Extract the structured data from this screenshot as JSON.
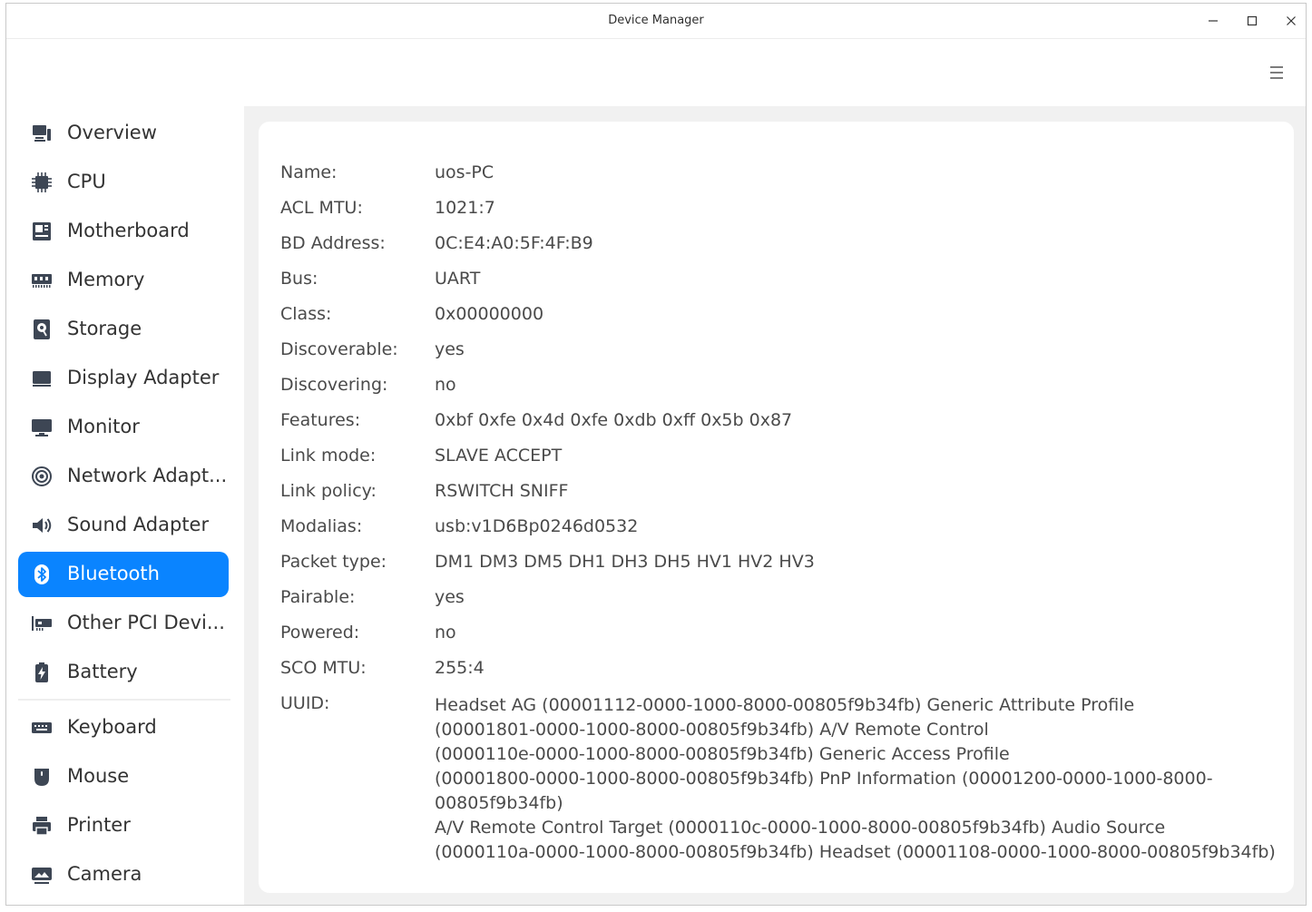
{
  "window": {
    "title": "Device Manager",
    "controls": {
      "minimize": "minimize",
      "maximize": "maximize",
      "close": "close"
    }
  },
  "sidebar": {
    "items": [
      {
        "label": "Overview",
        "icon": "overview-icon"
      },
      {
        "label": "CPU",
        "icon": "cpu-icon"
      },
      {
        "label": "Motherboard",
        "icon": "motherboard-icon"
      },
      {
        "label": "Memory",
        "icon": "memory-icon"
      },
      {
        "label": "Storage",
        "icon": "storage-icon"
      },
      {
        "label": "Display Adapter",
        "icon": "display-adapter-icon"
      },
      {
        "label": "Monitor",
        "icon": "monitor-icon"
      },
      {
        "label": "Network Adapt...",
        "icon": "network-icon"
      },
      {
        "label": "Sound Adapter",
        "icon": "sound-icon"
      },
      {
        "label": "Bluetooth",
        "icon": "bluetooth-icon",
        "selected": true
      },
      {
        "label": "Other PCI Devi...",
        "icon": "pci-icon"
      },
      {
        "label": "Battery",
        "icon": "battery-icon"
      }
    ],
    "peripherals": [
      {
        "label": "Keyboard",
        "icon": "keyboard-icon"
      },
      {
        "label": "Mouse",
        "icon": "mouse-icon"
      },
      {
        "label": "Printer",
        "icon": "printer-icon"
      },
      {
        "label": "Camera",
        "icon": "camera-icon"
      }
    ]
  },
  "details": {
    "properties": [
      {
        "key": "Name:",
        "value": "uos-PC"
      },
      {
        "key": "ACL MTU:",
        "value": "1021:7"
      },
      {
        "key": "BD Address:",
        "value": "0C:E4:A0:5F:4F:B9"
      },
      {
        "key": "Bus:",
        "value": "UART"
      },
      {
        "key": "Class:",
        "value": "0x00000000"
      },
      {
        "key": "Discoverable:",
        "value": "yes"
      },
      {
        "key": "Discovering:",
        "value": "no"
      },
      {
        "key": "Features:",
        "value": "0xbf 0xfe 0x4d 0xfe 0xdb 0xff 0x5b 0x87"
      },
      {
        "key": "Link mode:",
        "value": "SLAVE ACCEPT"
      },
      {
        "key": "Link policy:",
        "value": "RSWITCH SNIFF"
      },
      {
        "key": "Modalias:",
        "value": "usb:v1D6Bp0246d0532"
      },
      {
        "key": "Packet type:",
        "value": "DM1 DM3 DM5 DH1 DH3 DH5 HV1 HV2 HV3"
      },
      {
        "key": "Pairable:",
        "value": "yes"
      },
      {
        "key": "Powered:",
        "value": "no"
      },
      {
        "key": "SCO MTU:",
        "value": "255:4"
      }
    ],
    "uuid": {
      "key": "UUID:",
      "value": "Headset AG (00001112-0000-1000-8000-00805f9b34fb) Generic Attribute Profile\n(00001801-0000-1000-8000-00805f9b34fb) A/V Remote Control\n(0000110e-0000-1000-8000-00805f9b34fb) Generic Access Profile\n(00001800-0000-1000-8000-00805f9b34fb) PnP Information (00001200-0000-1000-8000-00805f9b34fb)\nA/V Remote Control Target (0000110c-0000-1000-8000-00805f9b34fb) Audio Source\n(0000110a-0000-1000-8000-00805f9b34fb) Headset (00001108-0000-1000-8000-00805f9b34fb)"
    }
  },
  "colors": {
    "accent": "#0a84ff",
    "content_bg": "#f1f1f1",
    "text": "#4a4a4a"
  }
}
